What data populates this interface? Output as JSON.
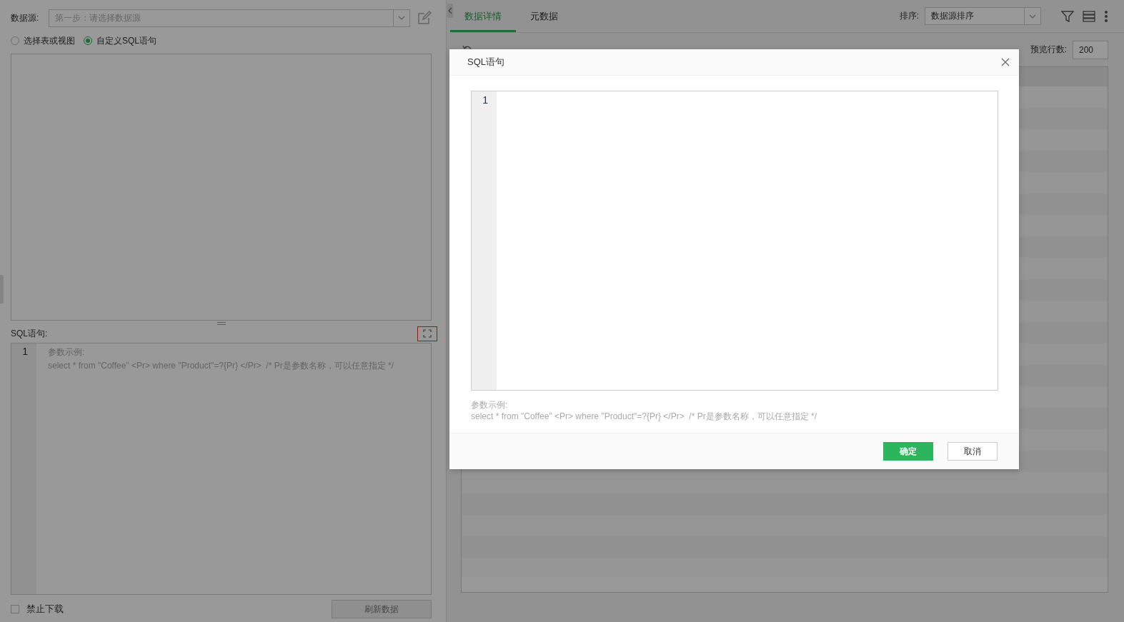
{
  "left_panel": {
    "datasource": {
      "label": "数据源:",
      "placeholder": "第一步：请选择数据源"
    },
    "source_modes": [
      {
        "label": "选择表或视图",
        "selected": false
      },
      {
        "label": "自定义SQL语句",
        "selected": true
      }
    ],
    "sql_label": "SQL语句:",
    "sql_editor": {
      "line_numbers": [
        "1"
      ],
      "hint_lines": [
        "参数示例:",
        "select * from \"Coffee\" <Pr> where \"Product\"=?{Pr} </Pr>  /* Pr是参数名称，可以任意指定 */"
      ]
    },
    "disable_download": {
      "label": "禁止下载",
      "checked": false
    },
    "refresh_button": {
      "label": "刷新数据",
      "disabled": true
    }
  },
  "right_panel": {
    "tabs": [
      {
        "label": "数据详情",
        "selected": true
      },
      {
        "label": "元数据",
        "selected": false
      }
    ],
    "sort": {
      "label": "排序:",
      "value": "数据源排序"
    },
    "preview_rows": {
      "label": "预览行数:",
      "value": "200"
    }
  },
  "dialog": {
    "title": "SQL语句",
    "editor": {
      "line_numbers": [
        "1"
      ]
    },
    "hint_lines": [
      "参数示例:",
      "select * from \"Coffee\" <Pr> where \"Product\"=?{Pr} </Pr>  /* Pr是参数名称，可以任意指定 */"
    ],
    "buttons": [
      {
        "label": "确定",
        "kind": "primary"
      },
      {
        "label": "取消",
        "kind": "secondary"
      }
    ]
  }
}
